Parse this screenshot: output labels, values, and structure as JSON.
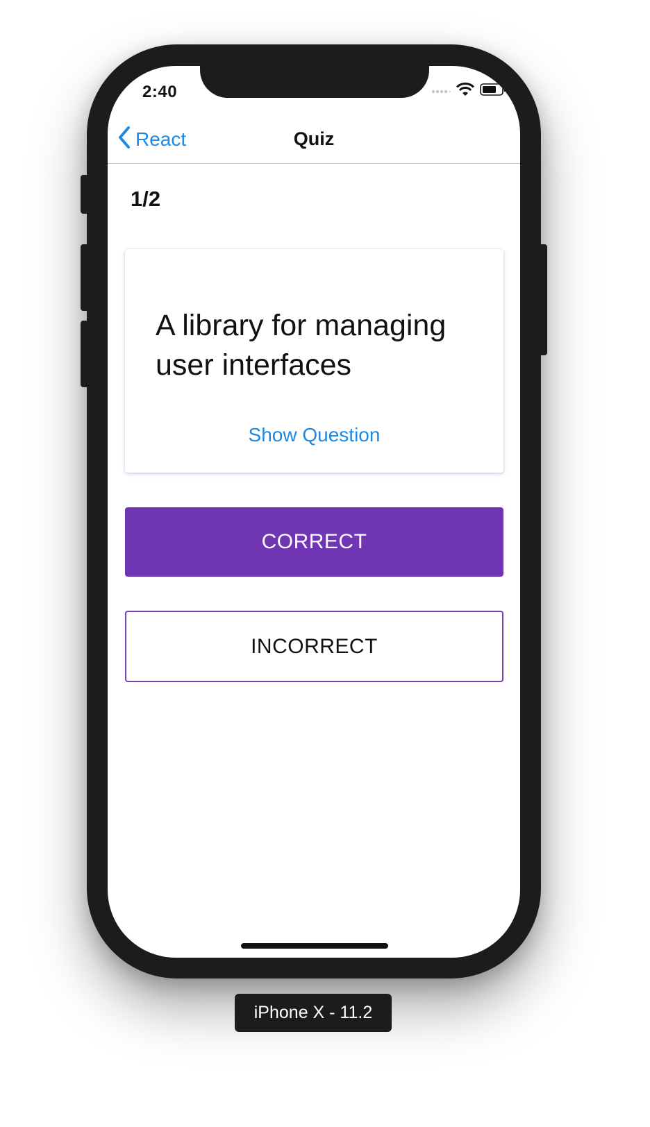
{
  "status_bar": {
    "time": "2:40"
  },
  "nav": {
    "back_label": "React",
    "title": "Quiz"
  },
  "quiz": {
    "counter": "1/2",
    "card_text": "A library for managing user interfaces",
    "toggle_label": "Show Question"
  },
  "buttons": {
    "correct": "CORRECT",
    "incorrect": "INCORRECT"
  },
  "simulator": {
    "label": "iPhone X - 11.2"
  },
  "colors": {
    "accent_purple": "#6f35b3",
    "link_blue": "#1e88e5",
    "device": "#1c1c1c"
  },
  "icons": [
    "chevron-left-icon",
    "signal-dots-icon",
    "wifi-icon",
    "battery-icon"
  ]
}
